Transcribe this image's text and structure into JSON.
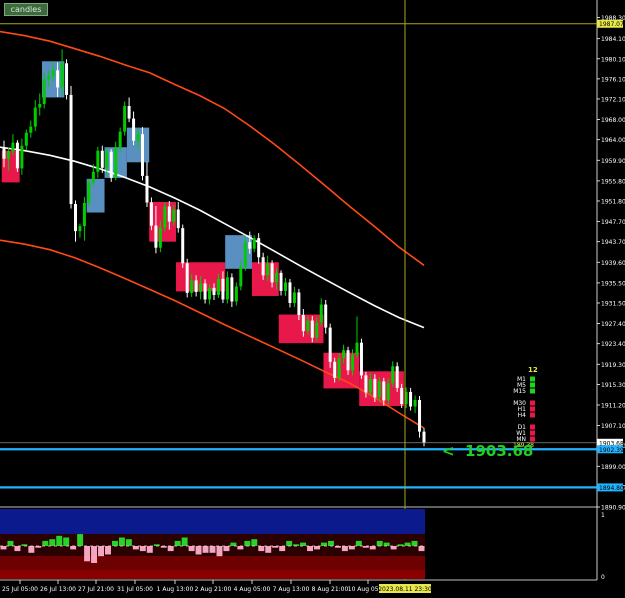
{
  "indicator_button": "candles",
  "big_price_label": "<  1903.68",
  "colors": {
    "background": "#000000",
    "bull_candle": "#00cc00",
    "bear_candle": "#ffffff",
    "bull_box": "#5a8fc2",
    "bear_box": "#e8194a",
    "upper_band": "#ff4a16",
    "lower_band": "#ff4a16",
    "mid_line": "#ffffff",
    "yellow_line": "#a8a820",
    "cyan_line": "#22b3ff",
    "axis_text": "#ffffff",
    "badge_green": "#1fd21f",
    "badge_red": "#e8194a"
  },
  "timeframes": {
    "count_label": "12",
    "items": [
      {
        "label": "M1",
        "state": "green"
      },
      {
        "label": "M5",
        "state": "green"
      },
      {
        "label": "M15",
        "state": "green"
      },
      {
        "label": "M30",
        "state": "red"
      },
      {
        "label": "H1",
        "state": "red"
      },
      {
        "label": "H4",
        "state": "red"
      },
      {
        "label": "D1",
        "state": "red"
      },
      {
        "label": "W1",
        "state": "red"
      },
      {
        "label": "MN",
        "state": "red"
      }
    ],
    "close_label": "189.38"
  },
  "chart_data": {
    "type": "candlestick",
    "price_axis": {
      "ylim": [
        1890.9,
        1991.0
      ],
      "ticks": [
        "1988.30",
        "1984.10",
        "1980.10",
        "1976.10",
        "1972.10",
        "1968.00",
        "1964.00",
        "1959.90",
        "1955.80",
        "1951.80",
        "1947.70",
        "1943.70",
        "1939.60",
        "1935.50",
        "1931.50",
        "1927.40",
        "1923.40",
        "1919.30",
        "1915.30",
        "1911.20",
        "1907.10",
        "1903.10",
        "1899.00",
        "1894.90",
        "1890.90"
      ],
      "tick_values": [
        1988.3,
        1984.1,
        1980.1,
        1976.1,
        1972.1,
        1968.0,
        1964.0,
        1959.9,
        1955.8,
        1951.8,
        1947.7,
        1943.7,
        1939.6,
        1935.5,
        1931.5,
        1927.4,
        1923.4,
        1919.3,
        1915.3,
        1911.2,
        1907.1,
        1903.1,
        1899.0,
        1894.9,
        1890.9
      ],
      "flags": [
        {
          "label": "1987.07",
          "value": 1987.07,
          "style": "yellow"
        },
        {
          "label": "1903.68",
          "value": 1903.68,
          "style": "white"
        },
        {
          "label": "1902.39",
          "value": 1902.39,
          "style": "cyan"
        },
        {
          "label": "1894.80",
          "value": 1894.8,
          "style": "cyan"
        }
      ]
    },
    "time_axis": {
      "ticks": [
        "25 Jul 05:00",
        "26 Jul 13:00",
        "27 Jul 21:00",
        "31 Jul 05:00",
        "1 Aug 13:00",
        "2 Aug 21:00",
        "4 Aug 05:00",
        "7 Aug 13:00",
        "8 Aug 21:00",
        "10 Aug 05:00"
      ],
      "tick_x": [
        20,
        58,
        96,
        135,
        175,
        213,
        252,
        291,
        330,
        368
      ],
      "current_time_label": "2023.08.11 23:30"
    },
    "horizontal_lines": [
      {
        "name": "yellow-level",
        "value": 1987.07
      },
      {
        "name": "cyan-level-1",
        "value": 1902.39
      },
      {
        "name": "cyan-level-2",
        "value": 1894.8
      }
    ],
    "vertical_line_x": 405,
    "candles": [
      [
        1962.3,
        1963.8,
        1958.5,
        1960.2
      ],
      [
        1960.2,
        1962.4,
        1957.8,
        1961.7
      ],
      [
        1961.7,
        1965.1,
        1960.9,
        1963.4
      ],
      [
        1963.4,
        1963.9,
        1957.6,
        1958.3
      ],
      [
        1958.3,
        1964.2,
        1957.0,
        1962.8
      ],
      [
        1962.8,
        1966.0,
        1961.9,
        1965.4
      ],
      [
        1965.4,
        1967.8,
        1964.4,
        1966.6
      ],
      [
        1966.6,
        1971.9,
        1965.7,
        1970.4
      ],
      [
        1970.4,
        1973.2,
        1968.8,
        1971.1
      ],
      [
        1971.1,
        1977.4,
        1970.2,
        1976.0
      ],
      [
        1976.0,
        1977.9,
        1974.5,
        1976.6
      ],
      [
        1976.6,
        1979.6,
        1975.7,
        1977.8
      ],
      [
        1977.8,
        1979.4,
        1972.5,
        1974.4
      ],
      [
        1974.4,
        1982.0,
        1972.8,
        1979.2
      ],
      [
        1979.2,
        1980.0,
        1972.0,
        1972.9
      ],
      [
        1972.9,
        1974.7,
        1950.3,
        1951.2
      ],
      [
        1951.2,
        1951.9,
        1943.7,
        1945.8
      ],
      [
        1945.8,
        1947.3,
        1944.5,
        1946.8
      ],
      [
        1946.8,
        1952.6,
        1943.9,
        1951.4
      ],
      [
        1951.4,
        1956.2,
        1950.8,
        1955.5
      ],
      [
        1955.5,
        1959.1,
        1954.9,
        1957.6
      ],
      [
        1957.6,
        1962.6,
        1956.4,
        1961.8
      ],
      [
        1961.8,
        1962.8,
        1957.4,
        1958.4
      ],
      [
        1958.4,
        1962.4,
        1956.9,
        1961.6
      ],
      [
        1961.6,
        1962.1,
        1955.6,
        1956.4
      ],
      [
        1956.4,
        1963.6,
        1955.9,
        1962.5
      ],
      [
        1962.5,
        1966.4,
        1961.3,
        1965.6
      ],
      [
        1965.6,
        1971.6,
        1964.8,
        1970.7
      ],
      [
        1970.7,
        1972.4,
        1967.5,
        1968.2
      ],
      [
        1968.2,
        1969.6,
        1962.9,
        1963.8
      ],
      [
        1963.8,
        1966.4,
        1962.1,
        1965.1
      ],
      [
        1965.1,
        1966.5,
        1955.9,
        1956.8
      ],
      [
        1956.8,
        1959.6,
        1950.6,
        1951.5
      ],
      [
        1951.5,
        1952.5,
        1946.0,
        1946.9
      ],
      [
        1946.9,
        1950.8,
        1941.4,
        1942.5
      ],
      [
        1942.5,
        1947.9,
        1941.6,
        1946.5
      ],
      [
        1946.5,
        1951.6,
        1945.8,
        1950.7
      ],
      [
        1950.7,
        1951.8,
        1946.1,
        1947.7
      ],
      [
        1947.7,
        1951.0,
        1946.9,
        1950.1
      ],
      [
        1950.1,
        1951.6,
        1945.5,
        1946.4
      ],
      [
        1946.4,
        1947.1,
        1938.5,
        1939.4
      ],
      [
        1939.4,
        1940.3,
        1932.6,
        1933.5
      ],
      [
        1933.5,
        1937.3,
        1932.7,
        1936.0
      ],
      [
        1936.0,
        1937.0,
        1932.8,
        1933.7
      ],
      [
        1933.7,
        1936.9,
        1932.2,
        1935.4
      ],
      [
        1935.4,
        1936.2,
        1931.4,
        1932.2
      ],
      [
        1932.2,
        1935.2,
        1931.2,
        1934.5
      ],
      [
        1934.5,
        1935.4,
        1932.1,
        1933.1
      ],
      [
        1933.1,
        1937.3,
        1932.5,
        1936.3
      ],
      [
        1936.3,
        1937.8,
        1931.5,
        1932.2
      ],
      [
        1932.2,
        1937.8,
        1931.4,
        1936.6
      ],
      [
        1936.6,
        1937.4,
        1930.7,
        1931.8
      ],
      [
        1931.8,
        1935.6,
        1931.0,
        1934.8
      ],
      [
        1934.8,
        1939.9,
        1934.0,
        1938.7
      ],
      [
        1938.7,
        1944.9,
        1937.9,
        1943.6
      ],
      [
        1943.6,
        1945.7,
        1941.3,
        1942.3
      ],
      [
        1942.3,
        1945.0,
        1941.6,
        1944.4
      ],
      [
        1944.4,
        1945.4,
        1939.3,
        1940.6
      ],
      [
        1940.6,
        1941.5,
        1936.1,
        1937.0
      ],
      [
        1937.0,
        1940.9,
        1935.8,
        1939.4
      ],
      [
        1939.4,
        1940.0,
        1934.6,
        1935.6
      ],
      [
        1935.6,
        1938.5,
        1934.2,
        1937.5
      ],
      [
        1937.5,
        1938.0,
        1933.0,
        1933.9
      ],
      [
        1933.9,
        1936.5,
        1932.9,
        1935.6
      ],
      [
        1935.6,
        1936.3,
        1930.6,
        1931.5
      ],
      [
        1931.5,
        1934.7,
        1930.7,
        1933.6
      ],
      [
        1933.6,
        1934.3,
        1928.1,
        1929.1
      ],
      [
        1929.1,
        1930.3,
        1924.8,
        1925.9
      ],
      [
        1925.9,
        1928.9,
        1925.2,
        1928.0
      ],
      [
        1928.0,
        1928.9,
        1923.7,
        1924.6
      ],
      [
        1924.6,
        1928.7,
        1923.9,
        1927.6
      ],
      [
        1927.6,
        1932.4,
        1926.9,
        1931.2
      ],
      [
        1931.2,
        1932.1,
        1925.4,
        1926.6
      ],
      [
        1926.6,
        1927.4,
        1918.6,
        1919.8
      ],
      [
        1919.8,
        1920.6,
        1915.7,
        1916.6
      ],
      [
        1916.6,
        1921.5,
        1915.9,
        1920.5
      ],
      [
        1920.5,
        1923.2,
        1919.5,
        1922.1
      ],
      [
        1922.1,
        1922.8,
        1917.2,
        1918.1
      ],
      [
        1918.1,
        1922.3,
        1917.1,
        1921.2
      ],
      [
        1921.2,
        1928.8,
        1920.6,
        1923.6
      ],
      [
        1923.6,
        1924.4,
        1916.4,
        1917.1
      ],
      [
        1917.1,
        1917.8,
        1912.7,
        1913.7
      ],
      [
        1913.7,
        1917.6,
        1913.0,
        1916.4
      ],
      [
        1916.4,
        1917.3,
        1911.8,
        1912.7
      ],
      [
        1912.7,
        1916.7,
        1911.9,
        1915.9
      ],
      [
        1915.9,
        1916.6,
        1911.1,
        1912.1
      ],
      [
        1912.1,
        1916.5,
        1911.3,
        1915.5
      ],
      [
        1915.5,
        1919.9,
        1914.8,
        1918.9
      ],
      [
        1918.9,
        1919.7,
        1913.8,
        1914.6
      ],
      [
        1914.6,
        1915.4,
        1910.6,
        1911.4
      ],
      [
        1911.4,
        1914.7,
        1910.6,
        1913.8
      ],
      [
        1913.8,
        1914.6,
        1910.1,
        1910.9
      ],
      [
        1910.9,
        1913.1,
        1909.6,
        1912.2
      ],
      [
        1912.2,
        1913.0,
        1904.7,
        1905.9
      ],
      [
        1905.9,
        1906.6,
        1903.0,
        1903.7
      ]
    ],
    "boxes": [
      {
        "from": 0,
        "to": 3,
        "high": 1961.8,
        "low": 1955.5,
        "dir": "bear"
      },
      {
        "from": 9,
        "to": 13,
        "high": 1979.6,
        "low": 1972.4,
        "dir": "bull"
      },
      {
        "from": 19,
        "to": 22,
        "high": 1956.2,
        "low": 1949.5,
        "dir": "bull"
      },
      {
        "from": 23,
        "to": 27,
        "high": 1962.5,
        "low": 1956.4,
        "dir": "bull"
      },
      {
        "from": 28,
        "to": 32,
        "high": 1966.4,
        "low": 1959.5,
        "dir": "bull"
      },
      {
        "from": 33,
        "to": 38,
        "high": 1951.6,
        "low": 1943.7,
        "dir": "bear"
      },
      {
        "from": 39,
        "to": 49,
        "high": 1939.6,
        "low": 1933.8,
        "dir": "bear"
      },
      {
        "from": 50,
        "to": 55,
        "high": 1945.0,
        "low": 1938.3,
        "dir": "bull"
      },
      {
        "from": 56,
        "to": 61,
        "high": 1939.6,
        "low": 1932.9,
        "dir": "bear"
      },
      {
        "from": 62,
        "to": 71,
        "high": 1929.2,
        "low": 1923.5,
        "dir": "bear"
      },
      {
        "from": 72,
        "to": 79,
        "high": 1921.6,
        "low": 1914.5,
        "dir": "bear"
      },
      {
        "from": 80,
        "to": 89,
        "high": 1917.9,
        "low": 1911.0,
        "dir": "bear"
      }
    ],
    "moving_average": [
      1962.5,
      1961.8,
      1960.9,
      1959.7,
      1958.2,
      1956.5,
      1954.6,
      1952.4,
      1950.0,
      1947.3,
      1944.6,
      1941.8,
      1939.0,
      1936.3,
      1933.6,
      1931.0,
      1928.6,
      1926.6
    ],
    "upper_band": [
      1985.5,
      1984.7,
      1983.6,
      1982.1,
      1980.6,
      1978.9,
      1977.3,
      1975.0,
      1972.8,
      1970.2,
      1966.8,
      1963.1,
      1959.1,
      1955.0,
      1950.8,
      1946.8,
      1942.6,
      1939.0
    ],
    "lower_band": [
      1944.0,
      1943.2,
      1942.1,
      1940.5,
      1938.5,
      1936.4,
      1934.2,
      1932.0,
      1929.6,
      1927.2,
      1924.9,
      1922.6,
      1920.3,
      1917.9,
      1915.6,
      1912.8,
      1909.6,
      1906.6
    ],
    "oscillator": {
      "axis_labels": [
        "1",
        "0"
      ],
      "bars": [
        -2,
        3,
        -3,
        1,
        -4,
        -1,
        3,
        4,
        6,
        5,
        -2,
        7,
        -9,
        -10,
        -6,
        -5,
        3,
        5,
        4,
        -2,
        -3,
        -4,
        1,
        -1,
        -3,
        3,
        5,
        -3,
        -5,
        -4,
        -4,
        -6,
        -3,
        2,
        -2,
        3,
        4,
        -3,
        -4,
        -1,
        -3,
        3,
        1,
        2,
        -3,
        -2,
        2,
        3,
        -1,
        -3,
        -2,
        3,
        -1,
        -2,
        3,
        2,
        -2,
        1,
        2,
        3,
        -3
      ]
    }
  }
}
